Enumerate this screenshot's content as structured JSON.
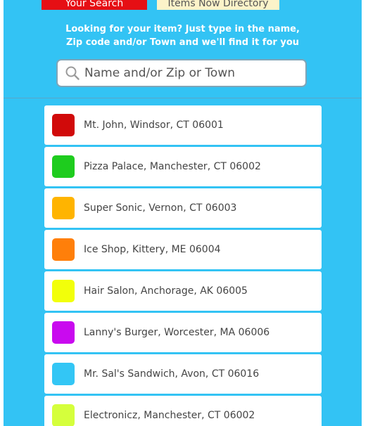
{
  "tabs": {
    "search_label": "Your Search",
    "directory_label": "Items Now Directory"
  },
  "instructions": {
    "line1": "Looking for your item? Just type in the name,",
    "line2": "Zip code and/or Town and we'll find it for you"
  },
  "search": {
    "placeholder": "Name and/or Zip or Town",
    "value": ""
  },
  "results": [
    {
      "label": "Mt. John, Windsor, CT 06001",
      "color": "#d10a0a"
    },
    {
      "label": "Pizza Palace, Manchester, CT 06002",
      "color": "#1ecc1e"
    },
    {
      "label": "Super Sonic, Vernon, CT 06003",
      "color": "#ffb400"
    },
    {
      "label": "Ice Shop, Kittery, ME 06004",
      "color": "#ff7f0a"
    },
    {
      "label": "Hair Salon, Anchorage, AK 06005",
      "color": "#f2ff0a"
    },
    {
      "label": "Lanny's Burger, Worcester, MA 06006",
      "color": "#c90aef"
    },
    {
      "label": "Mr. Sal's Sandwich, Avon, CT 06016",
      "color": "#33c6f5"
    },
    {
      "label": "Electronicz, Manchester, CT 06002",
      "color": "#d5ff3c"
    }
  ]
}
